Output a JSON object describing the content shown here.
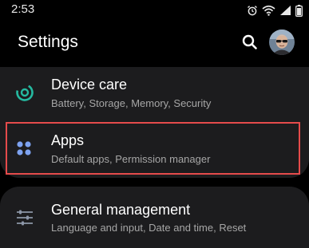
{
  "status_bar": {
    "time": "2:53"
  },
  "app_bar": {
    "title": "Settings",
    "search_icon": "search-icon",
    "avatar": "profile-avatar"
  },
  "items": [
    {
      "title": "Device care",
      "subtitle": "Battery, Storage, Memory, Security",
      "icon": "device-care-icon",
      "icon_color": "#25b9a0"
    },
    {
      "title": "Apps",
      "subtitle": "Default apps, Permission manager",
      "icon": "apps-grid-icon",
      "icon_color": "#7da2f0",
      "highlighted": true
    },
    {
      "title": "General management",
      "subtitle": "Language and input, Date and time, Reset",
      "icon": "sliders-icon",
      "icon_color": "#8c96a8"
    }
  ],
  "colors": {
    "background": "#000000",
    "card": "#1c1c1e",
    "highlight_border": "#e54b4b",
    "subtitle": "#a6a6a6"
  }
}
